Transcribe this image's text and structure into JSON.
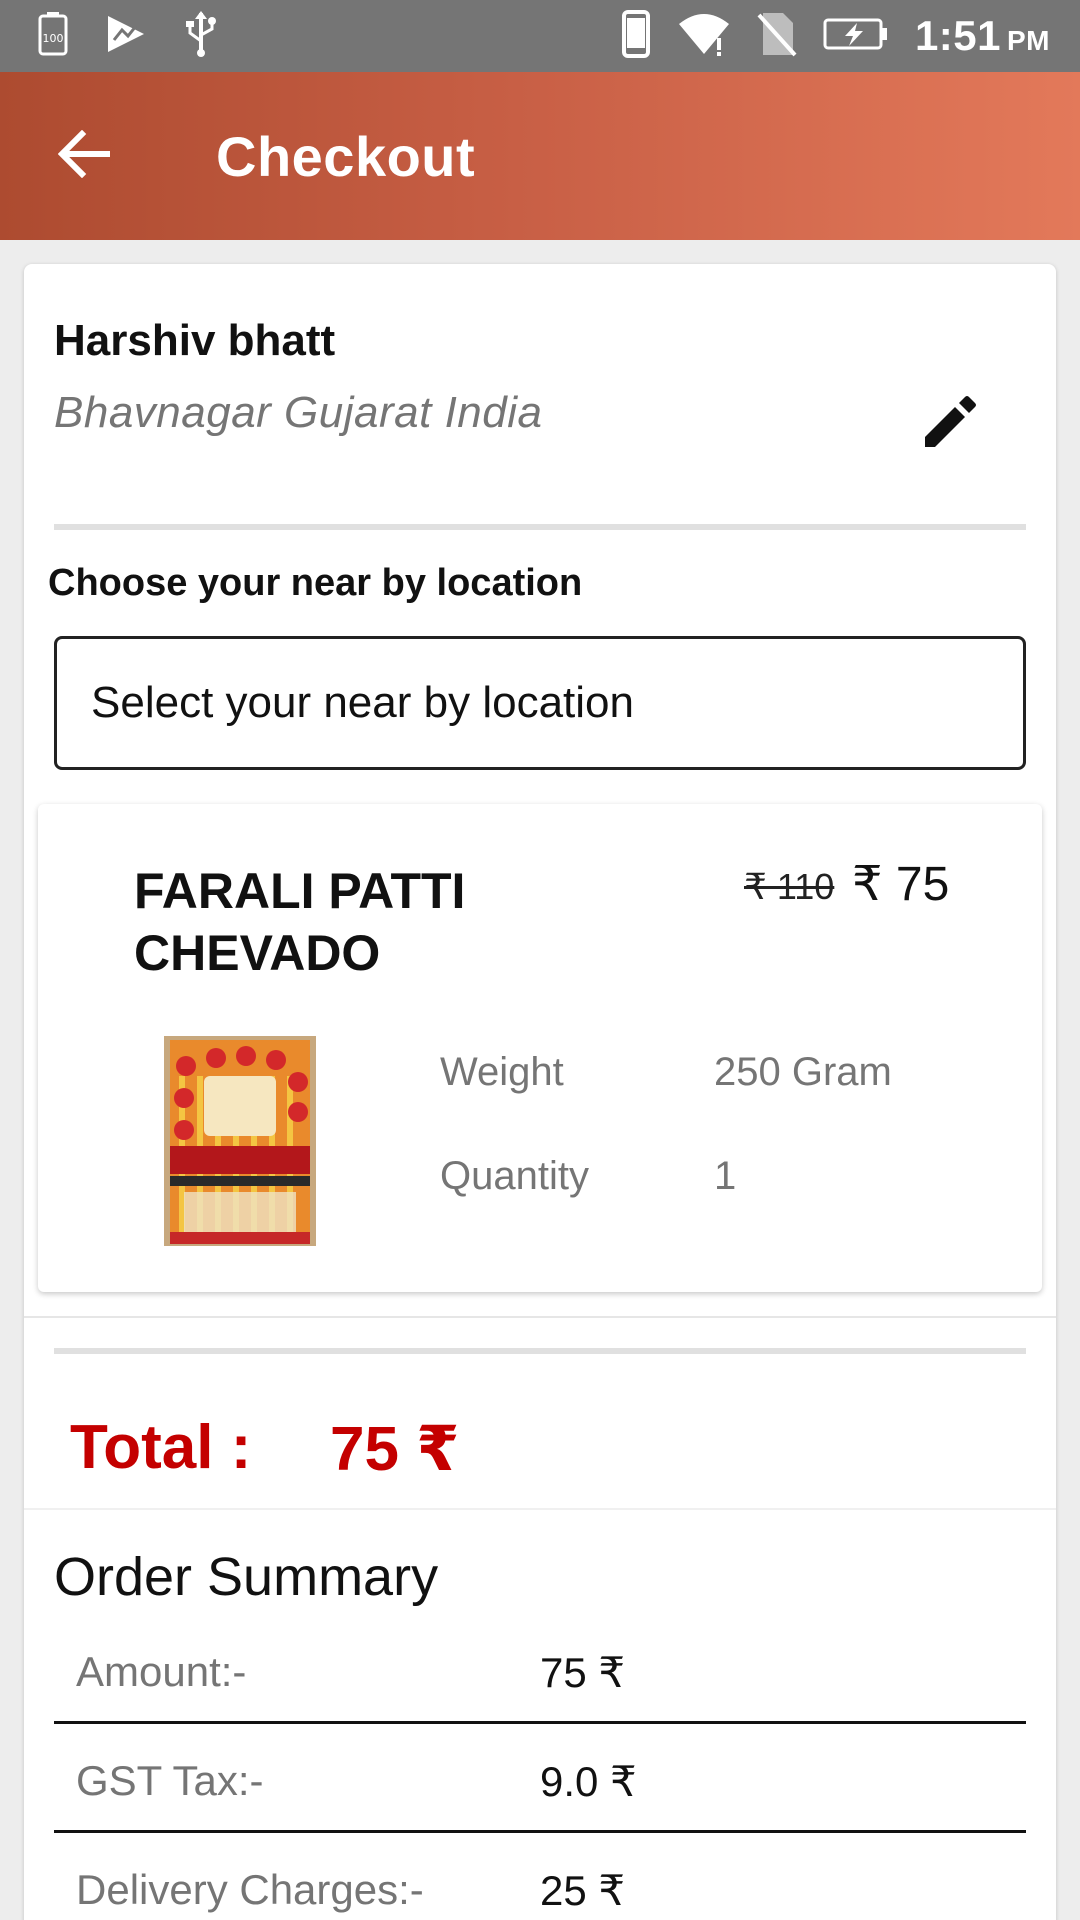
{
  "status_bar": {
    "time": "1:51",
    "ampm": "PM",
    "battery_level": "100"
  },
  "app_bar": {
    "title": "Checkout"
  },
  "address": {
    "name": "Harshiv bhatt",
    "location": "Bhavnagar Gujarat India"
  },
  "location_section": {
    "label": "Choose your near by location",
    "placeholder": "Select your near by location"
  },
  "product": {
    "name": "FARALI PATTI CHEVADO",
    "old_price": "₹ 110",
    "new_price": "₹ 75",
    "specs": [
      {
        "label": "Weight",
        "value": "250 Gram"
      },
      {
        "label": "Quantity",
        "value": "1"
      }
    ]
  },
  "total": {
    "label": "Total :",
    "value": "75 ₹"
  },
  "order_summary": {
    "title": "Order Summary",
    "rows": [
      {
        "label": "Amount:-",
        "value": "75 ₹"
      },
      {
        "label": "GST Tax:-",
        "value": "9.0 ₹"
      },
      {
        "label": "Delivery Charges:-",
        "value": "25 ₹"
      }
    ]
  },
  "colors": {
    "app_bar_start": "#ad4b30",
    "app_bar_end": "#e3795a",
    "total_red": "#c40000",
    "status_bar": "#757575"
  },
  "icons": [
    "battery-full-icon",
    "play-store-icon",
    "usb-icon",
    "phone-icon",
    "wifi-icon",
    "no-sim-icon",
    "battery-charging-icon",
    "arrow-back-icon",
    "edit-pencil-icon"
  ]
}
